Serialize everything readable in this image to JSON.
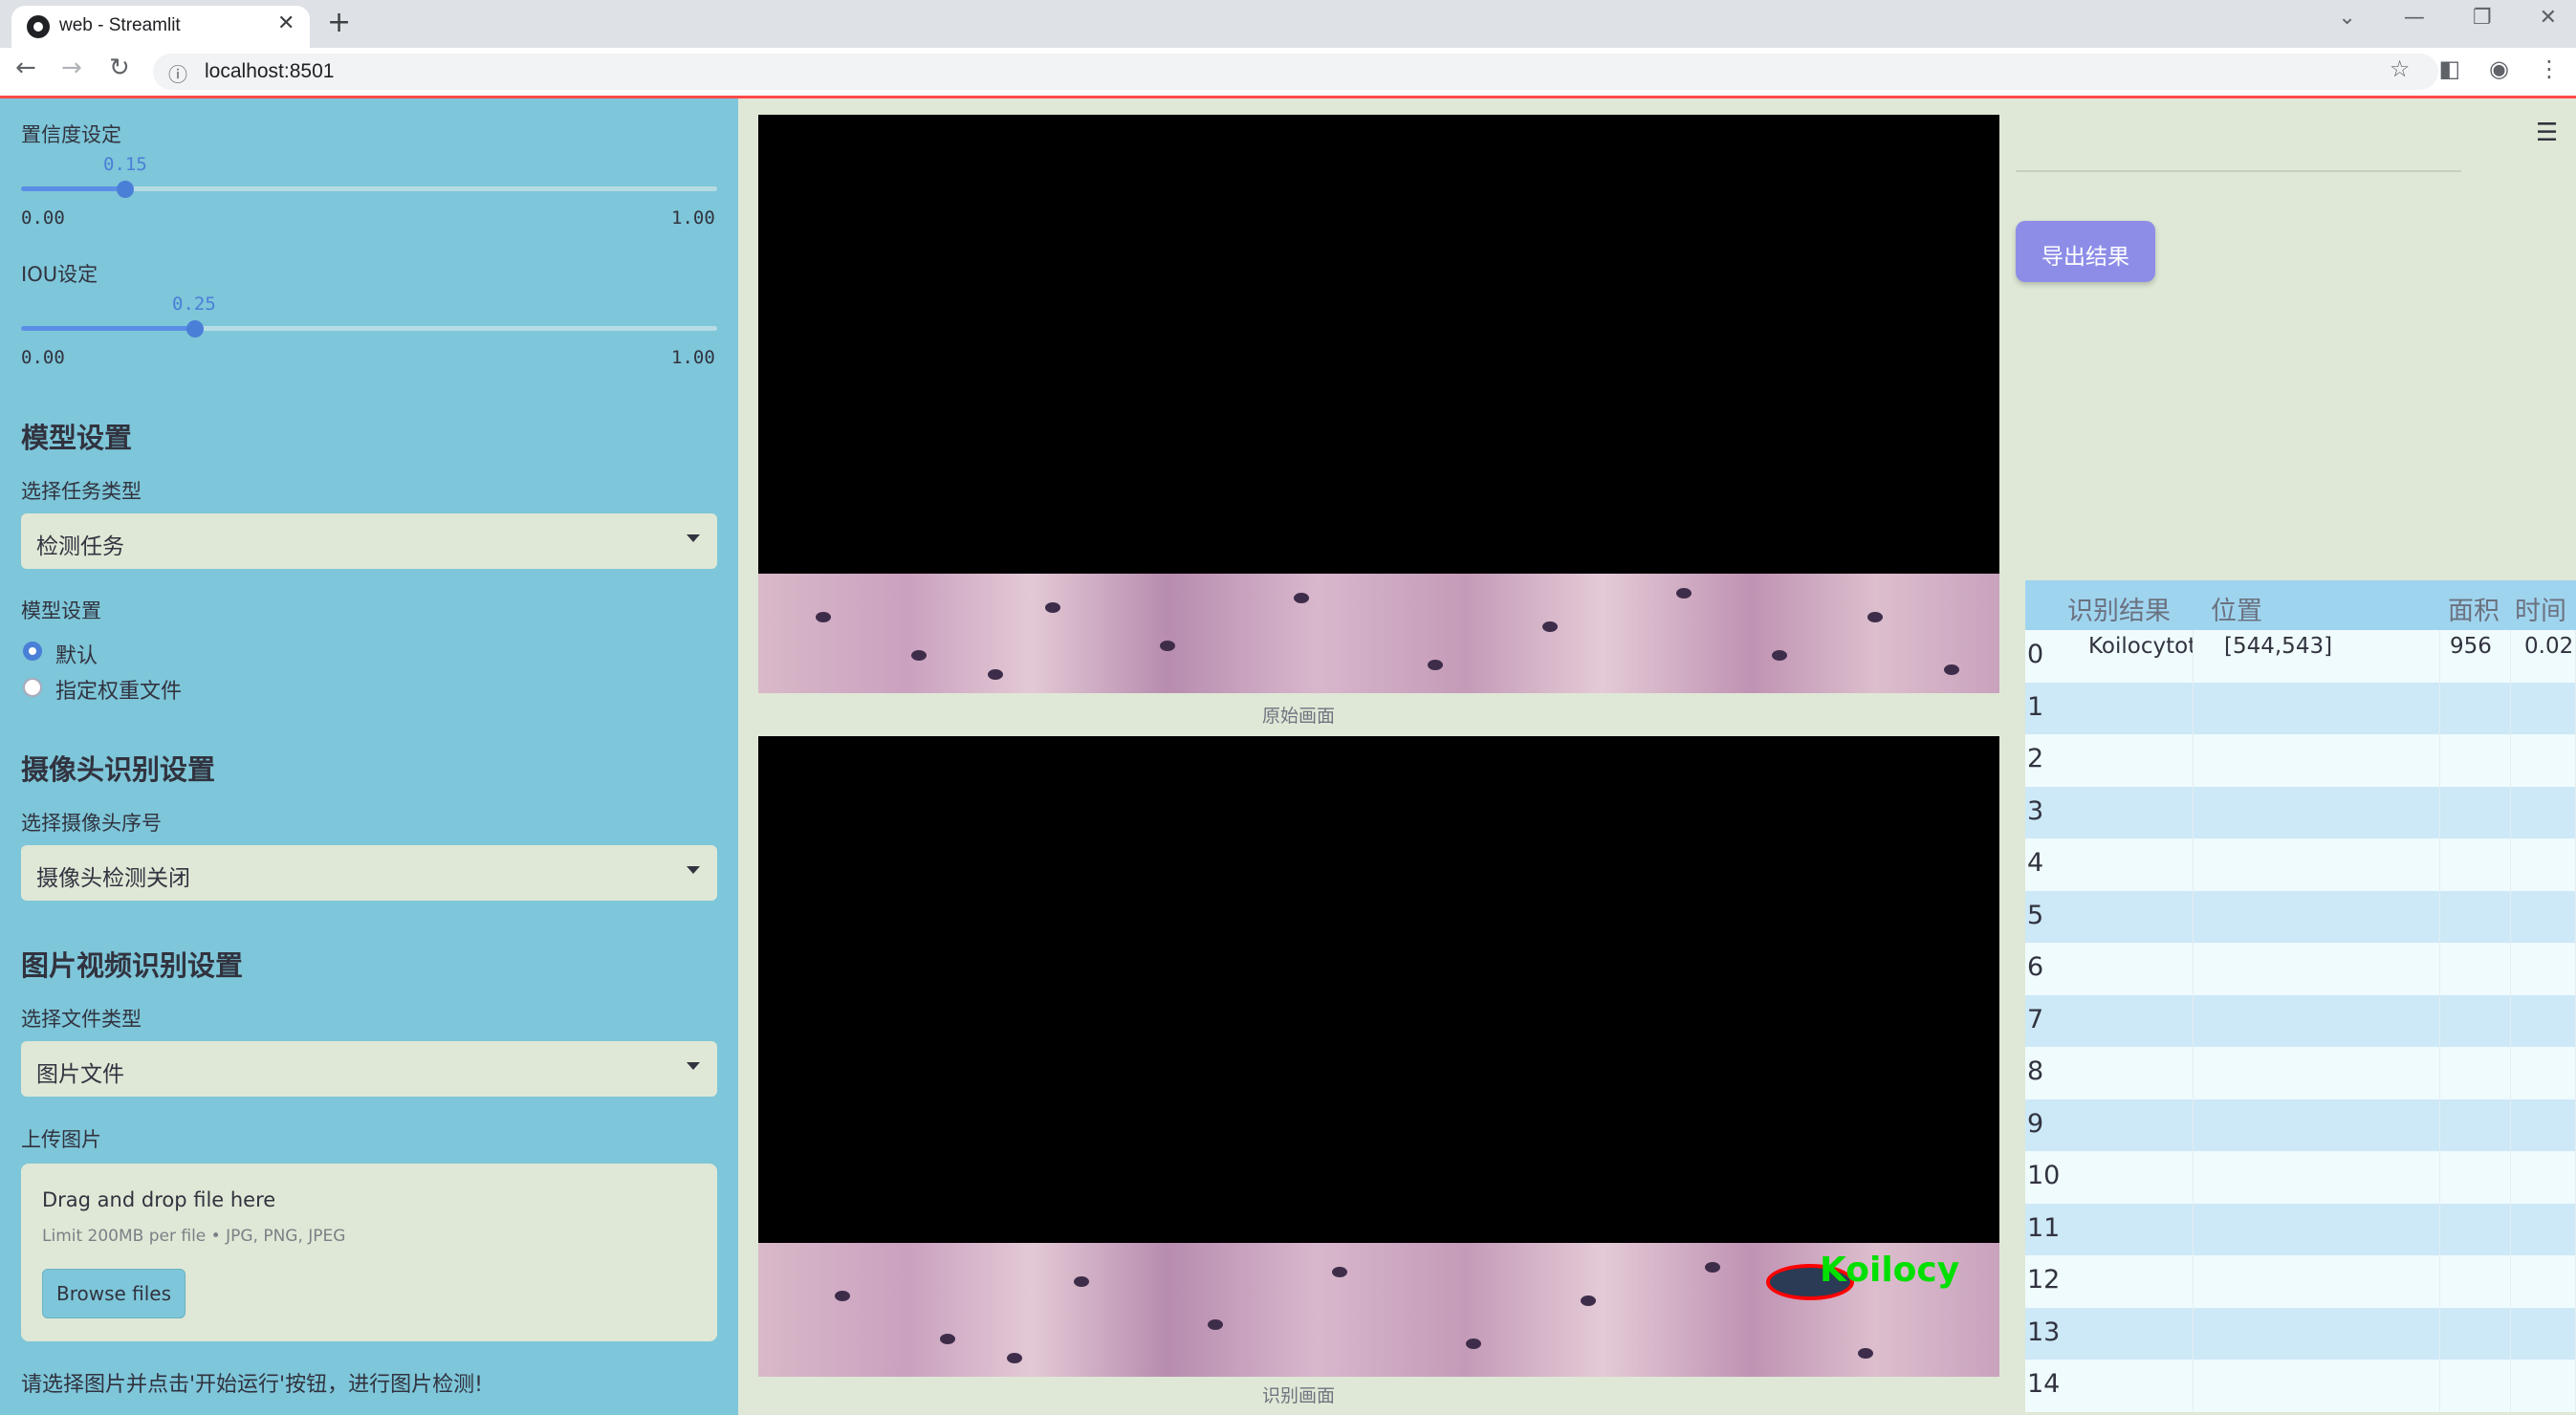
{
  "browser": {
    "tab_title": "web - Streamlit",
    "url": "localhost:8501"
  },
  "sidebar": {
    "confidence": {
      "label": "置信度设定",
      "value": "0.15",
      "min": "0.00",
      "max": "1.00",
      "fraction": 0.15
    },
    "iou": {
      "label": "IOU设定",
      "value": "0.25",
      "min": "0.00",
      "max": "1.00",
      "fraction": 0.25
    },
    "model_section": "模型设置",
    "task_type_label": "选择任务类型",
    "task_type_value": "检测任务",
    "model_setting_label": "模型设置",
    "radio_default": "默认",
    "radio_custom": "指定权重文件",
    "camera_section": "摄像头识别设置",
    "camera_label": "选择摄像头序号",
    "camera_value": "摄像头检测关闭",
    "media_section": "图片视频识别设置",
    "file_type_label": "选择文件类型",
    "file_type_value": "图片文件",
    "upload_label": "上传图片",
    "uploader_title": "Drag and drop file here",
    "uploader_limit": "Limit 200MB per file • JPG, PNG, JPEG",
    "browse_button": "Browse files",
    "hint": "请选择图片并点击'开始运行'按钮，进行图片检测!"
  },
  "main": {
    "original_caption": "原始画面",
    "result_caption": "识别画面",
    "detection_label": "Koilocy",
    "export_button": "导出结果"
  },
  "table": {
    "headers": [
      "",
      "识别结果",
      "位置",
      "面积",
      "时间"
    ],
    "rows": [
      [
        "0",
        "Koilocytotic",
        "[544,543]",
        "956",
        "0.02"
      ],
      [
        "1",
        "",
        "",
        "",
        ""
      ],
      [
        "2",
        "",
        "",
        "",
        ""
      ],
      [
        "3",
        "",
        "",
        "",
        ""
      ],
      [
        "4",
        "",
        "",
        "",
        ""
      ],
      [
        "5",
        "",
        "",
        "",
        ""
      ],
      [
        "6",
        "",
        "",
        "",
        ""
      ],
      [
        "7",
        "",
        "",
        "",
        ""
      ],
      [
        "8",
        "",
        "",
        "",
        ""
      ],
      [
        "9",
        "",
        "",
        "",
        ""
      ],
      [
        "10",
        "",
        "",
        "",
        ""
      ],
      [
        "11",
        "",
        "",
        "",
        ""
      ],
      [
        "12",
        "",
        "",
        "",
        ""
      ],
      [
        "13",
        "",
        "",
        "",
        ""
      ],
      [
        "14",
        "",
        "",
        "",
        ""
      ]
    ]
  },
  "colors": {
    "sidebar_bg": "#7ec6d9",
    "main_bg": "#dfe8d6",
    "accent": "#4a7fd8",
    "export_button": "#8d8de8",
    "detection_box": "#ff0000",
    "detection_text": "#00e000"
  }
}
